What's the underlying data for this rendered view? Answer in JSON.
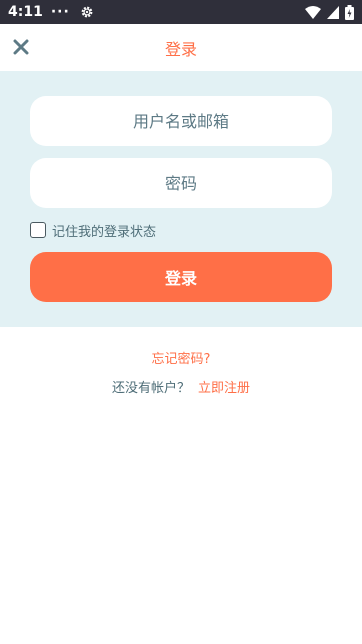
{
  "status_bar": {
    "time": "4:11",
    "dots": "···",
    "icons": [
      "gear-icon",
      "wifi-icon",
      "signal-icon",
      "battery-icon"
    ]
  },
  "app_bar": {
    "title": "登录",
    "close_icon": "close-icon"
  },
  "form": {
    "username_placeholder": "用户名或邮箱",
    "password_placeholder": "密码",
    "remember_label": "记住我的登录状态",
    "remember_checked": false,
    "login_button": "登录"
  },
  "links": {
    "forgot_password": "忘记密码?",
    "no_account_prompt": "还没有帐户？",
    "register_now": "立即注册"
  },
  "colors": {
    "accent": "#ff6f47",
    "panel_bg": "#e2f1f4",
    "text_muted": "#4f6e78",
    "status_bar": "#2f2f3a"
  }
}
